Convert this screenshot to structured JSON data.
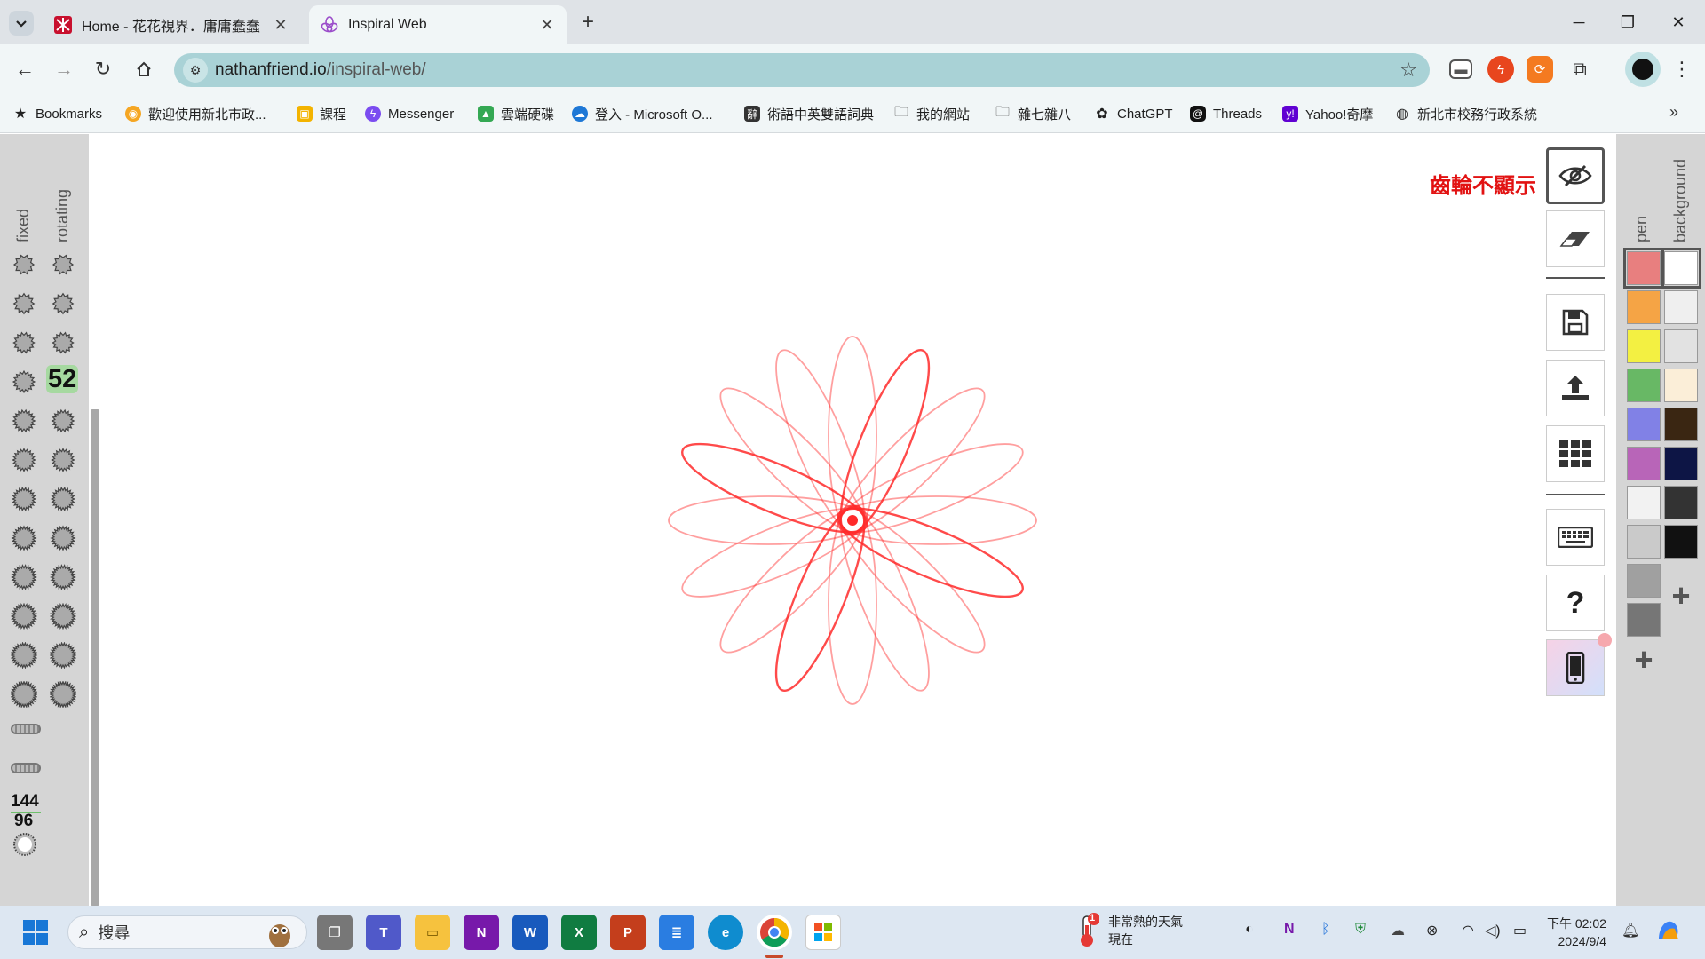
{
  "browser": {
    "tabs": [
      {
        "title": "Home - 花花視界．庸庸蠢蠢",
        "active": false
      },
      {
        "title": "Inspiral Web",
        "active": true
      }
    ],
    "url_host": "nathanfriend.io",
    "url_path": "/inspiral-web/",
    "bookmarks": [
      {
        "label": "Bookmarks",
        "icon": "star-icon"
      },
      {
        "label": "歡迎使用新北市政...",
        "icon": "ntpc-icon"
      },
      {
        "label": "課程",
        "icon": "classroom-icon"
      },
      {
        "label": "Messenger",
        "icon": "messenger-icon"
      },
      {
        "label": "雲端硬碟",
        "icon": "drive-icon"
      },
      {
        "label": "登入 - Microsoft O...",
        "icon": "onedrive-icon"
      },
      {
        "label": "術語中英雙語詞典",
        "icon": "dictionary-icon"
      },
      {
        "label": "我的網站",
        "icon": "folder-icon"
      },
      {
        "label": "雜七雜八",
        "icon": "folder-icon"
      },
      {
        "label": "ChatGPT",
        "icon": "chatgpt-icon"
      },
      {
        "label": "Threads",
        "icon": "threads-icon"
      },
      {
        "label": "Yahoo!奇摩",
        "icon": "yahoo-icon"
      },
      {
        "label": "新北市校務行政系統",
        "icon": "globe-icon"
      }
    ]
  },
  "app": {
    "left_panel": {
      "fixed_label": "fixed",
      "rotating_label": "rotating",
      "selected_gear_number": "52",
      "ratio_top": "144",
      "ratio_bottom": "96"
    },
    "note": "齒輪不顯示",
    "tools": [
      {
        "name": "hide-gears-button",
        "icon": "eye-slash-icon",
        "selected": true
      },
      {
        "name": "eraser-button",
        "icon": "eraser-icon",
        "selected": false
      },
      {
        "name": "save-button",
        "icon": "floppy-disk-icon",
        "selected": false
      },
      {
        "name": "upload-button",
        "icon": "upload-icon",
        "selected": false
      },
      {
        "name": "gallery-button",
        "icon": "grid-icon",
        "selected": false
      },
      {
        "name": "keyboard-button",
        "icon": "keyboard-icon",
        "selected": false
      },
      {
        "name": "help-button",
        "icon": "question-icon",
        "selected": false
      },
      {
        "name": "mobile-button",
        "icon": "phone-icon",
        "selected": false
      }
    ],
    "right_panel": {
      "pen_label": "pen",
      "background_label": "background",
      "pen_colors": [
        "#e87f7f",
        "#f5a445",
        "#f3f042",
        "#68b865",
        "#8181e6",
        "#b865b8",
        "#f2f2f2",
        "#cacaca",
        "#a0a0a0",
        "#767676"
      ],
      "background_colors": [
        "#ffffff",
        "#efefef",
        "#e2e2e2",
        "#fbeed8",
        "#3a2612",
        "#0d1545",
        "#333333",
        "#111111"
      ],
      "selected_pen_color": "#e87f7f",
      "selected_background_color": "#ffffff"
    },
    "spirograph": {
      "color": "#ff2a2a",
      "petals": 16,
      "fixed_teeth": 144,
      "rotating_teeth": 96
    }
  },
  "taskbar": {
    "search_placeholder": "搜尋",
    "weather_title": "非常熱的天氣",
    "weather_sub": "現在",
    "weather_badge": "1",
    "time": "下午 02:02",
    "date": "2024/9/4"
  }
}
